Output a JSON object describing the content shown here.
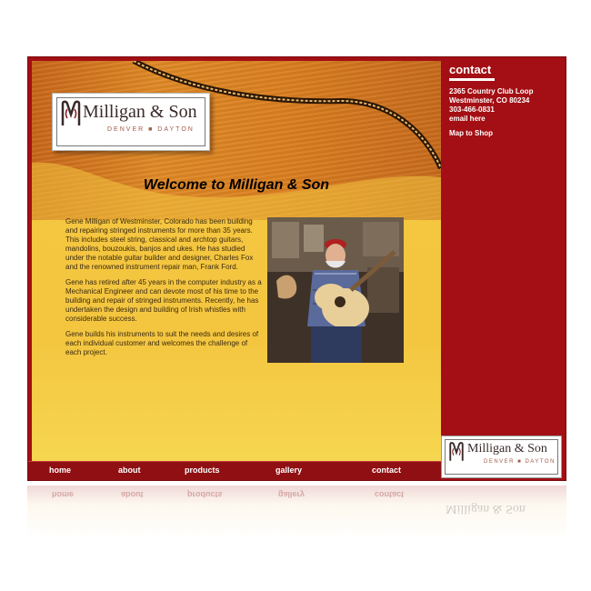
{
  "site": {
    "logo_text": "Milligan & Son",
    "logo_sub": "DENVER ■ DAYTON"
  },
  "main": {
    "heading": "Welcome to Milligan & Son",
    "paragraphs": [
      "Gene Milligan of Westminster, Colorado has been building and repairing stringed instruments for more than 35 years. This includes steel string, classical and archtop guitars, mandolins, bouzoukis, banjos and ukes. He has studied under the notable guitar builder and designer, Charles Fox and the renowned instrument repair man, Frank Ford.",
      "Gene has retired after 45 years in the computer industry as a Mechanical Engineer and can devote most of his time to the building and repair of stringed instruments. Recently, he has undertaken the design and building of Irish whistles with considerable success.",
      "Gene builds his instruments to suit the needs and desires of each individual customer and welcomes the challenge of each project."
    ]
  },
  "nav": {
    "items": [
      {
        "label": "home"
      },
      {
        "label": "about"
      },
      {
        "label": "products"
      },
      {
        "label": "gallery"
      },
      {
        "label": "contact"
      }
    ]
  },
  "sidebar": {
    "title": "contact",
    "lines": [
      "2365 Country Club Loop",
      "Westminster, CO 80234",
      "303-466-0831",
      "email here"
    ],
    "map_link": "Map to Shop"
  },
  "colors": {
    "frame": "#a30f14",
    "nav": "#8f0f13",
    "gold": "#f4c640",
    "wood": "#dc8020"
  }
}
